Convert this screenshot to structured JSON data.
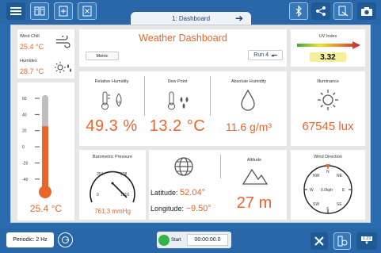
{
  "toolbar": {
    "menu_icon": "hamburger-icon",
    "pages_icon": "pages-icon",
    "add_icon": "add-page-icon",
    "delete_icon": "delete-page-icon",
    "bluetooth_icon": "bluetooth-icon",
    "share_icon": "share-icon",
    "annotate_icon": "annotate-icon",
    "camera_icon": "camera-icon"
  },
  "tab": {
    "label": "1: Dashboard"
  },
  "dashboard": {
    "title": "Weather Dashboard",
    "metric_button": "Metric",
    "run_label": "Run 4",
    "wind_chill": {
      "label": "Wind Chill",
      "value": "25.4 °C"
    },
    "humidex": {
      "label": "Humidex",
      "value": "28.7 °C"
    },
    "thermometer": {
      "ticks": [
        "60",
        "40",
        "20",
        "0",
        "-20",
        "-40"
      ],
      "value": "25.4 °C",
      "level": 25.4,
      "min": -50,
      "max": 60
    },
    "uv": {
      "label": "UV Index",
      "value": "3.32"
    },
    "relative_humidity": {
      "label": "Relative Humidity",
      "value": "49.3 %"
    },
    "dew_point": {
      "label": "Dew Point",
      "value": "13.2 °C"
    },
    "absolute_humidity": {
      "label": "Absolute Humidity",
      "value": "11.6 g/m³"
    },
    "illuminance": {
      "label": "Illuminance",
      "value": "67545 lux"
    },
    "pressure": {
      "label": "Barometric Pressure",
      "value": "761.3 mmHg",
      "ticks": [
        "254",
        "508",
        "0",
        "1016"
      ]
    },
    "location": {
      "latitude_label": "Latitude:",
      "latitude_value": "52.04°",
      "longitude_label": "Longitude:",
      "longitude_value": "−9.50°"
    },
    "altitude": {
      "label": "Altitude",
      "value": "27 m"
    },
    "wind": {
      "label": "Wind Direction",
      "speed": "0.0kph",
      "dirs": {
        "n": "N",
        "ne": "NE",
        "e": "E",
        "se": "SE",
        "s": "S",
        "sw": "SW",
        "w": "W",
        "nw": "NW"
      }
    }
  },
  "bottom": {
    "periodic": "Periodic: 2 Hz",
    "start": "Start",
    "timer": "00:00:00.0",
    "numbers_badge": "1.23"
  },
  "colors": {
    "accent": "#e8652c",
    "bar": "#2a67a8",
    "green": "#35b34a"
  }
}
